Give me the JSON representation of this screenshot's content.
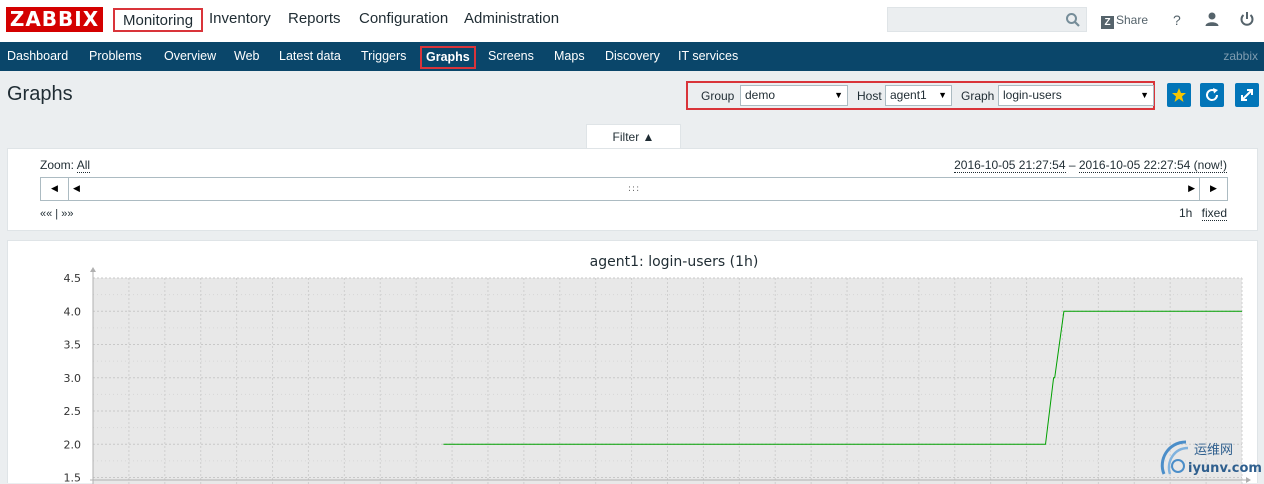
{
  "header": {
    "logo_text": "ZABBIX",
    "menu": [
      {
        "label": "Monitoring",
        "active": true
      },
      {
        "label": "Inventory",
        "active": false
      },
      {
        "label": "Reports",
        "active": false
      },
      {
        "label": "Configuration",
        "active": false
      },
      {
        "label": "Administration",
        "active": false
      }
    ],
    "search_value": "",
    "share_label": "Share",
    "help_label": "?"
  },
  "subnav": {
    "items": [
      {
        "label": "Dashboard",
        "active": false
      },
      {
        "label": "Problems",
        "active": false
      },
      {
        "label": "Overview",
        "active": false
      },
      {
        "label": "Web",
        "active": false
      },
      {
        "label": "Latest data",
        "active": false
      },
      {
        "label": "Triggers",
        "active": false
      },
      {
        "label": "Graphs",
        "active": true
      },
      {
        "label": "Screens",
        "active": false
      },
      {
        "label": "Maps",
        "active": false
      },
      {
        "label": "Discovery",
        "active": false
      },
      {
        "label": "IT services",
        "active": false
      }
    ],
    "brand": "zabbix"
  },
  "page": {
    "title": "Graphs",
    "group_label": "Group",
    "group_value": "demo",
    "host_label": "Host",
    "host_value": "agent1",
    "graph_label": "Graph",
    "graph_value": "login-users"
  },
  "filter": {
    "tab_label": "Filter ▲",
    "zoom_label": "Zoom:",
    "zoom_all": "All",
    "period_start": "2016-10-05 21:27:54",
    "period_sep": " – ",
    "period_end": "2016-10-05 22:27:54",
    "period_now": " (now!)",
    "nav_links": "«« | »»",
    "length_label": "1h",
    "fixed_label": "fixed"
  },
  "colors": {
    "brand_red": "#d40000",
    "nav_blue": "#0a466a",
    "button_blue": "#0275b8",
    "series_green": "#00a000",
    "highlight_red": "#d9343a"
  },
  "chart_data": {
    "type": "line",
    "title": "agent1: login-users (1h)",
    "xlabel": "",
    "ylabel": "",
    "y_ticks": [
      1.5,
      2.0,
      2.5,
      3.0,
      3.5,
      4.0,
      4.5
    ],
    "ylim": [
      1.5,
      4.5
    ],
    "x_fraction_range": [
      0,
      1
    ],
    "series": [
      {
        "color": "#00a000",
        "points": [
          {
            "x": 0.305,
            "y": 2.0
          },
          {
            "x": 0.829,
            "y": 2.0
          },
          {
            "x": 0.836,
            "y": 3.0
          },
          {
            "x": 0.837,
            "y": 3.0
          },
          {
            "x": 0.845,
            "y": 4.0
          },
          {
            "x": 1.0,
            "y": 4.0
          }
        ]
      }
    ],
    "grid": true
  },
  "watermark": {
    "text_cn": "运维网",
    "text_en": "iyunv.com"
  }
}
